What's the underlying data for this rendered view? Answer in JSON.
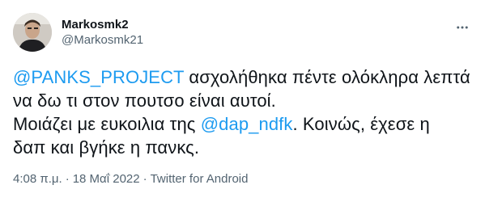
{
  "user": {
    "display_name": "Markosmk2",
    "handle": "@Markosmk21"
  },
  "more_icon": "more-horizontal-icon",
  "tweet": {
    "line1_mention": "@PANKS_PROJECT",
    "line1_text": " ασχολήθηκα πέντε ολόκληρα λεπτά",
    "line2_text": "να δω τι στον πουτσο είναι αυτοί.",
    "line3_text_before": "Μοιάζει με ευκοιλια της ",
    "line3_mention": "@dap_ndfk",
    "line3_text_after": ". Κοινώς, έχεσε η",
    "line4_text": "δαπ και βγήκε η πανκς."
  },
  "meta": {
    "time": "4:08 π.μ.",
    "separator1": "·",
    "date": "18 Μαΐ 2022",
    "separator2": "·",
    "source": "Twitter for Android"
  },
  "colors": {
    "mention": "#1d9bf0",
    "text": "#0f1419",
    "secondary": "#536471"
  }
}
